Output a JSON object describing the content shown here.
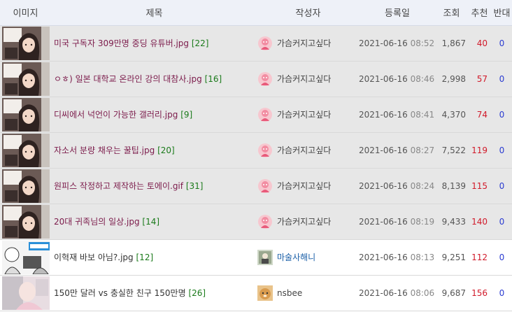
{
  "header": {
    "image": "이미지",
    "title": "제목",
    "author": "작성자",
    "date": "등록일",
    "views": "조회",
    "recommend": "추천",
    "oppose": "반대"
  },
  "rows": [
    {
      "title": "미국 구독자 309만명 중딩 유튜버.jpg",
      "comments": "[22]",
      "author": "가슴커지고싶다",
      "avatar": "pink-avatar",
      "date": "2021-06-16",
      "time": "08:52",
      "views": "1,867",
      "recommend": "40",
      "oppose": "0",
      "thumb": "anime-girl-thumb"
    },
    {
      "title": "ㅇㅎ) 일본 대학교 온라인 강의 대참사.jpg",
      "comments": "[16]",
      "author": "가슴커지고싶다",
      "avatar": "pink-avatar",
      "date": "2021-06-16",
      "time": "08:46",
      "views": "2,998",
      "recommend": "57",
      "oppose": "0",
      "thumb": "anime-girl-thumb"
    },
    {
      "title": "디씨에서 넉언이 가능한 갤러리.jpg",
      "comments": "[9]",
      "author": "가슴커지고싶다",
      "avatar": "pink-avatar",
      "date": "2021-06-16",
      "time": "08:41",
      "views": "4,370",
      "recommend": "74",
      "oppose": "0",
      "thumb": "anime-girl-thumb"
    },
    {
      "title": "자소서 분량 채우는 꿀팁.jpg",
      "comments": "[20]",
      "author": "가슴커지고싶다",
      "avatar": "pink-avatar",
      "date": "2021-06-16",
      "time": "08:27",
      "views": "7,522",
      "recommend": "119",
      "oppose": "0",
      "thumb": "anime-girl-thumb"
    },
    {
      "title": "원피스 작정하고 제작하는 토에이.gif",
      "comments": "[31]",
      "author": "가슴커지고싶다",
      "avatar": "pink-avatar",
      "date": "2021-06-16",
      "time": "08:24",
      "views": "8,139",
      "recommend": "115",
      "oppose": "0",
      "thumb": "anime-girl-thumb"
    },
    {
      "title": "20대 귀족님의 일상.jpg",
      "comments": "[14]",
      "author": "가슴커지고싶다",
      "avatar": "pink-avatar",
      "date": "2021-06-16",
      "time": "08:19",
      "views": "9,433",
      "recommend": "140",
      "oppose": "0",
      "thumb": "anime-girl-thumb"
    },
    {
      "title": "이혁재 바보 아님?.jpg",
      "comments": "[12]",
      "author": "마술사해니",
      "avatar": "magician-avatar",
      "date": "2021-06-16",
      "time": "08:13",
      "views": "9,251",
      "recommend": "112",
      "oppose": "0",
      "thumb": "comic-thumb"
    },
    {
      "title": "150만 달러 vs 충실한 친구 150만명",
      "comments": "[26]",
      "author": "nsbee",
      "avatar": "dog-avatar",
      "date": "2021-06-16",
      "time": "08:06",
      "views": "9,687",
      "recommend": "156",
      "oppose": "0",
      "thumb": "photo-thumb"
    }
  ],
  "colors": {
    "highlight_row": "#e7e7e7",
    "title_link": "#7b1a4a",
    "comment_count": "#1a7a1a",
    "recommend": "#d11a2a",
    "oppose": "#2a3bd1"
  }
}
